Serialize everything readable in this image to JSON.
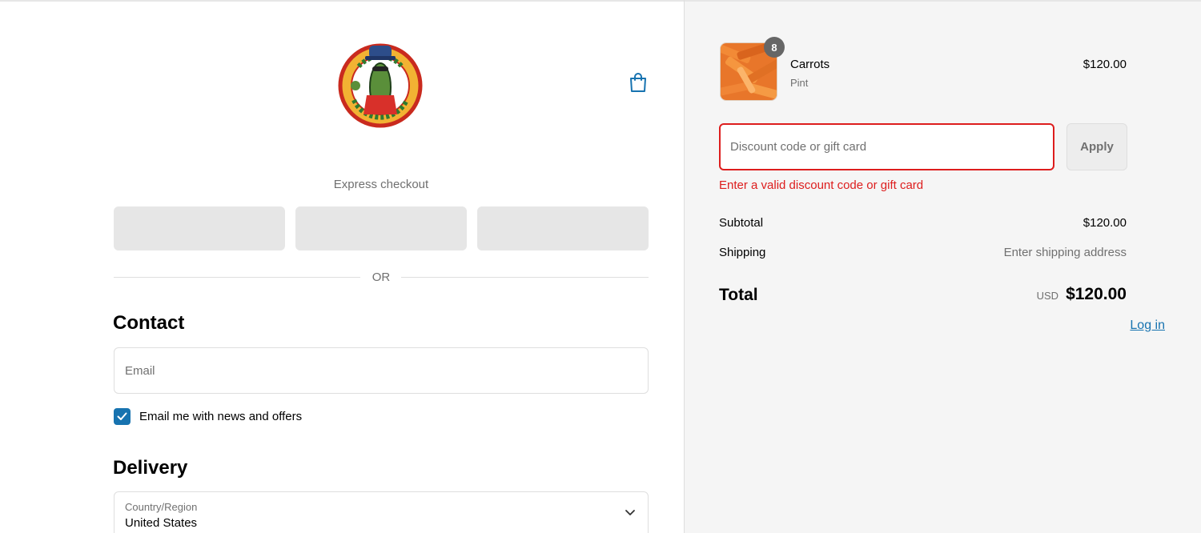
{
  "logo": {
    "icon": "pickle-mascot-logo"
  },
  "header": {
    "cart_icon": "shopping-bag-icon"
  },
  "express": {
    "label": "Express checkout",
    "buttons": [
      "",
      "",
      ""
    ],
    "or_text": "OR"
  },
  "contact": {
    "title": "Contact",
    "login_label": "Log in",
    "email_placeholder": "Email",
    "email_value": "",
    "newsletter_label": "Email me with news and offers",
    "newsletter_checked": true
  },
  "delivery": {
    "title": "Delivery",
    "country_label": "Country/Region",
    "country_value": "United States"
  },
  "order": {
    "item": {
      "name": "Carrots",
      "variant": "Pint",
      "price": "$120.00",
      "quantity": "8",
      "image_icon": "carrot-sticks-photo"
    },
    "discount_placeholder": "Discount code or gift card",
    "apply_label": "Apply",
    "discount_error": "Enter a valid discount code or gift card",
    "subtotal_label": "Subtotal",
    "subtotal_value": "$120.00",
    "shipping_label": "Shipping",
    "shipping_value": "Enter shipping address",
    "total_label": "Total",
    "total_currency": "USD",
    "total_value": "$120.00"
  },
  "colors": {
    "accent": "#1773b0",
    "error": "#dd1d1d",
    "summary_bg": "#f5f5f5"
  }
}
